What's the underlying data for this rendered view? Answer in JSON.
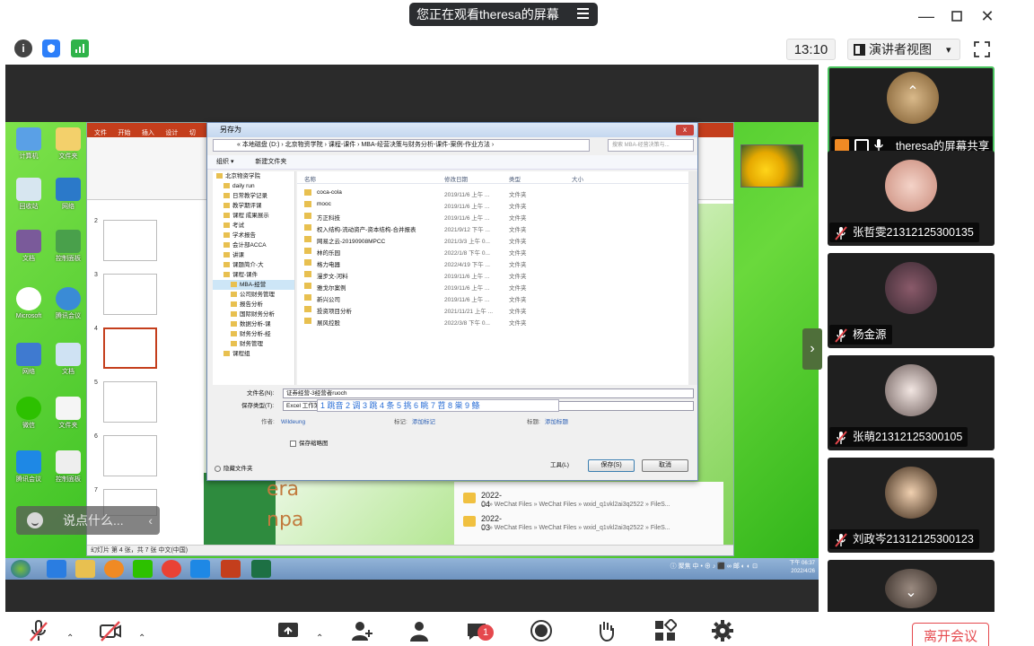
{
  "title_bar": {
    "share_text": "您正在观看theresa的屏幕",
    "min_label": "—",
    "max_label": "☐",
    "close_label": "✕"
  },
  "toolbar": {
    "time": "13:10",
    "view_label": "演讲者视图",
    "view_caret": "▾"
  },
  "shared_screen": {
    "desktop_icons": [
      "计算机",
      "回收站",
      "网络",
      "文档",
      "控制面板",
      "Microsoft",
      "腾讯会议",
      "微信",
      "文件夹"
    ],
    "ppt": {
      "tabs": [
        "文件",
        "开始",
        "插入",
        "设计",
        "切"
      ],
      "slide_title_line1": "era",
      "slide_title_line2": "npa",
      "thumb_numbers": [
        "2",
        "3",
        "4",
        "5",
        "6",
        "7"
      ],
      "status": "幻灯片 第 4 张，共 7 张    中文(中国)"
    },
    "save_dialog": {
      "title": "另存为",
      "close_label": "x",
      "address": "« 本地磁盘 (D:) › 北京物资学院 › 课程-课件 › MBA-经营决策与财务分析-课件-案例-作业方法 ›",
      "search_placeholder": "搜索 MBA-经营决策与...",
      "commands": [
        "组织 ▾",
        "新建文件夹"
      ],
      "tree": [
        "北京物资学院",
        "daily run",
        "日常教学记录",
        "教学期评课",
        "课程 成果展示",
        "考试",
        "学术报告",
        "会计部ACCA",
        "讲课",
        "课题简介-大",
        "课程-课件",
        "MBA-经营",
        "公司财务管理",
        "报告分析",
        "国际财务分析",
        "数据分析-课",
        "财务分析-经",
        "财务管理",
        "课程组"
      ],
      "columns": [
        "名称",
        "修改日期",
        "类型",
        "大小"
      ],
      "files": [
        {
          "name": "coca-cola",
          "date": "2019/11/6 上午 ...",
          "type": "文件夹"
        },
        {
          "name": "mooc",
          "date": "2019/11/6 上午 ...",
          "type": "文件夹"
        },
        {
          "name": "方正科技",
          "date": "2019/11/6 上午 ...",
          "type": "文件夹"
        },
        {
          "name": "权入结构-流动资产-资本结构-合并报表",
          "date": "2021/9/12 下午 ...",
          "type": "文件夹"
        },
        {
          "name": "网易之云-20190908MPCC",
          "date": "2021/3/3 上午 0...",
          "type": "文件夹"
        },
        {
          "name": "林的乐园",
          "date": "2022/1/8 下午 0...",
          "type": "文件夹"
        },
        {
          "name": "格力电器",
          "date": "2022/4/19 下午 ...",
          "type": "文件夹"
        },
        {
          "name": "漫步文-河料",
          "date": "2019/11/6 上午 ...",
          "type": "文件夹"
        },
        {
          "name": "雅戈尔案例",
          "date": "2019/11/6 上午 ...",
          "type": "文件夹"
        },
        {
          "name": "新兴公司",
          "date": "2019/11/6 上午 ...",
          "type": "文件夹"
        },
        {
          "name": "投资项目分析",
          "date": "2021/11/21 上午 ...",
          "type": "文件夹"
        },
        {
          "name": "展风控股",
          "date": "2022/3/8 下午 0...",
          "type": "文件夹"
        }
      ],
      "filename_label": "文件名(N):",
      "filename_value": "证券经营-3经营者ruoch",
      "filetype_label": "保存类型(T):",
      "filetype_value": "Excel 工作簿",
      "ime_candidates": "1 跳音  2 调  3 跳  4 条  5 挑  6 眺  7 苕  8 粜  9 鲦",
      "author_label": "作者:",
      "author_value": "Wildeung",
      "tag_label": "标记:",
      "tag_value": "添加标记",
      "title_label": "标题:",
      "title_value": "添加标题",
      "thumbnail_label": "保存缩略图",
      "hide_folders": "隐藏文件夹",
      "tools_label": "工具(L)",
      "save_label": "保存(S)",
      "cancel_label": "取消"
    },
    "wechat": [
      {
        "title": "2022-04",
        "path": "C: » WeChat Files » WeChat Files » wxid_q1vkl2ai3q2522 » FileS..."
      },
      {
        "title": "2022-03",
        "path": "C: » WeChat Files » WeChat Files » wxid_q1vkl2ai3q2522 » FileS..."
      }
    ],
    "tray_text": "ⓘ 聚焦 中 • ⊕ ♪ ⬛ ∞ 邮 ◐ ◐ ⊡",
    "tray_time_line1": "下午 06:37",
    "tray_time_line2": "2022/4/26",
    "chat_placeholder": "说点什么...",
    "chat_arrow": "‹"
  },
  "participants": [
    {
      "name": "theresa的屏幕共享",
      "muted": false,
      "avatar_color": "#c49a5c"
    },
    {
      "name": "张哲雯21312125300135",
      "muted": true,
      "avatar_color": "#e8b9a6"
    },
    {
      "name": "杨金源",
      "muted": true,
      "avatar_color": "#6b4b5a"
    },
    {
      "name": "张萌21312125300105",
      "muted": true,
      "avatar_color": "#d8c9c4"
    },
    {
      "name": "刘政岑21312125300123",
      "muted": true,
      "avatar_color": "#c9a382"
    }
  ],
  "bottom_bar": {
    "chat_badge": "1",
    "leave_label": "离开会议"
  },
  "colors": {
    "accent_green": "#48c25d",
    "danger_red": "#e5484d",
    "desktop_green": "#3fc325",
    "ppt_red": "#c43e1c"
  }
}
